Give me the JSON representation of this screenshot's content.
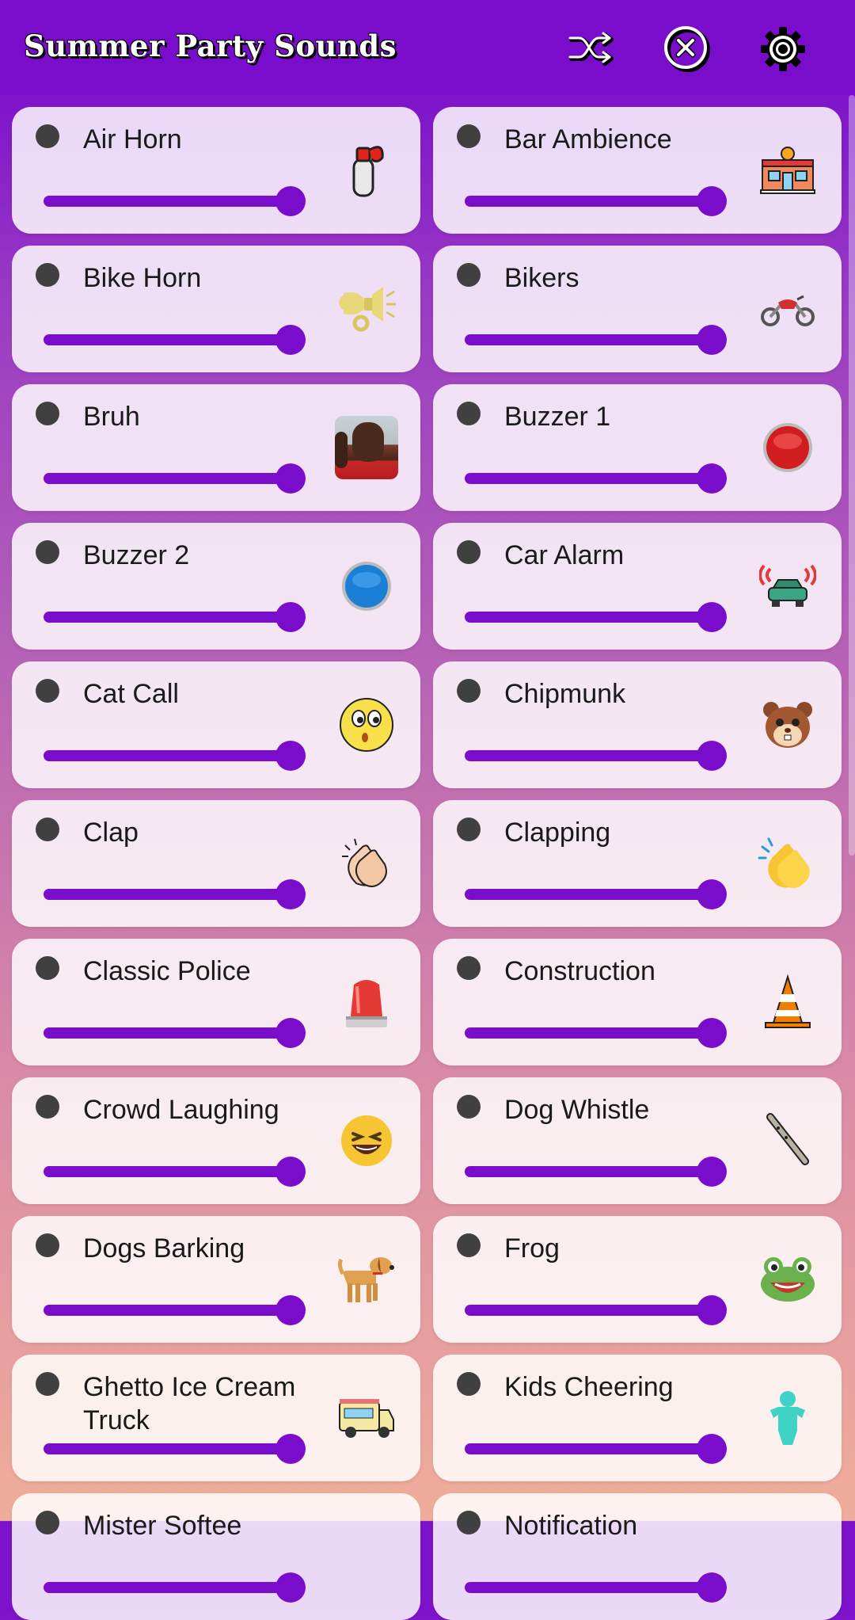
{
  "header": {
    "title": "Summer Party Sounds",
    "shuffle_icon": "shuffle-icon",
    "stop_icon": "stop-all-icon",
    "settings_icon": "gear-icon"
  },
  "colors": {
    "accent": "#7a0ccc",
    "dot": "#404040"
  },
  "sounds": [
    {
      "label": "Air Horn",
      "icon": "air-horn-icon",
      "volume": 1.0
    },
    {
      "label": "Bar Ambience",
      "icon": "bar-building-icon",
      "volume": 1.0
    },
    {
      "label": "Bike Horn",
      "icon": "bike-horn-icon",
      "volume": 1.0
    },
    {
      "label": "Bikers",
      "icon": "motorcycle-icon",
      "volume": 1.0
    },
    {
      "label": "Bruh",
      "icon": "bruh-photo",
      "volume": 1.0
    },
    {
      "label": "Buzzer 1",
      "icon": "red-buzzer-icon",
      "volume": 1.0
    },
    {
      "label": "Buzzer 2",
      "icon": "blue-buzzer-icon",
      "volume": 1.0
    },
    {
      "label": "Car Alarm",
      "icon": "car-alarm-icon",
      "volume": 1.0
    },
    {
      "label": "Cat Call",
      "icon": "whistling-face-icon",
      "volume": 1.0
    },
    {
      "label": "Chipmunk",
      "icon": "chipmunk-icon",
      "volume": 1.0
    },
    {
      "label": "Clap",
      "icon": "clap-hands-icon",
      "volume": 1.0
    },
    {
      "label": "Clapping",
      "icon": "clapping-hands-icon",
      "volume": 1.0
    },
    {
      "label": "Classic Police",
      "icon": "police-siren-icon",
      "volume": 1.0
    },
    {
      "label": "Construction",
      "icon": "traffic-cone-icon",
      "volume": 1.0
    },
    {
      "label": "Crowd Laughing",
      "icon": "laughing-face-icon",
      "volume": 1.0
    },
    {
      "label": "Dog Whistle",
      "icon": "whistle-icon",
      "volume": 1.0
    },
    {
      "label": "Dogs Barking",
      "icon": "dog-icon",
      "volume": 1.0
    },
    {
      "label": "Frog",
      "icon": "frog-icon",
      "volume": 1.0
    },
    {
      "label": "Ghetto Ice Cream Truck",
      "icon": "ice-cream-truck-icon",
      "volume": 1.0
    },
    {
      "label": "Kids Cheering",
      "icon": "child-icon",
      "volume": 1.0
    },
    {
      "label": "Mister Softee",
      "icon": "",
      "volume": 1.0
    },
    {
      "label": "Notification",
      "icon": "",
      "volume": 1.0
    }
  ]
}
